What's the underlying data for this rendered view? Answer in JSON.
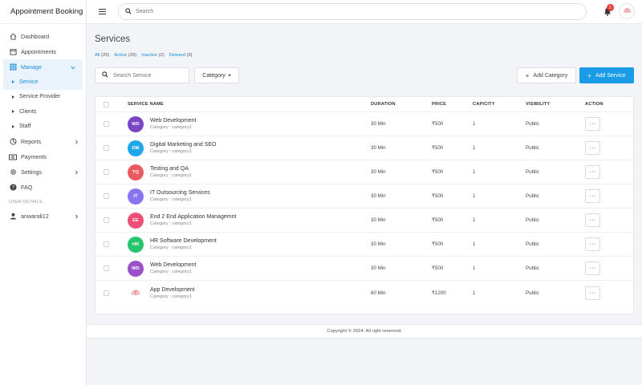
{
  "app": {
    "title": "Appointment Booking"
  },
  "topbar": {
    "search_placeholder": "Search",
    "notifications_count": "5"
  },
  "sidebar": {
    "items": [
      {
        "label": "Dashboard",
        "icon": "home-icon"
      },
      {
        "label": "Appointments",
        "icon": "calendar-icon"
      },
      {
        "label": "Manage",
        "icon": "grid-icon"
      },
      {
        "label": "Service"
      },
      {
        "label": "Service Provider"
      },
      {
        "label": "Clients"
      },
      {
        "label": "Staff"
      },
      {
        "label": "Reports",
        "icon": "reports-icon"
      },
      {
        "label": "Payments",
        "icon": "payments-icon"
      },
      {
        "label": "Settings",
        "icon": "gear-icon"
      },
      {
        "label": "FAQ",
        "icon": "help-icon"
      }
    ],
    "section_label": "USER DETAILS",
    "user": "anwarali12"
  },
  "page": {
    "title": "Services",
    "filters": [
      {
        "label": "All",
        "count": "(25)"
      },
      {
        "label": "Active",
        "count": "(20)"
      },
      {
        "label": "Inactive",
        "count": "(2)"
      },
      {
        "label": "Deleted",
        "count": "(3)"
      }
    ],
    "search_placeholder": "Search Service",
    "category_label": "Category",
    "add_category_label": "Add Category",
    "add_service_label": "Add Service"
  },
  "table": {
    "columns": [
      "SERVICE NAME",
      "DURATION",
      "PRICE",
      "CAPICITY",
      "VISIBILITY",
      "ACTION"
    ],
    "rows": [
      {
        "initials": "WD",
        "color": "#7b45c6",
        "name": "Web Development",
        "category": "Category : category1",
        "duration": "30 Min",
        "price": "₹500",
        "capacity": "1",
        "visibility": "Public"
      },
      {
        "initials": "DM",
        "color": "#1ea7ea",
        "name": "Digital Marketing and SEO",
        "category": "Category : category1",
        "duration": "30 Min",
        "price": "₹500",
        "capacity": "1",
        "visibility": "Public"
      },
      {
        "initials": "TQ",
        "color": "#ea5a5f",
        "name": "Testing and QA",
        "category": "Category : category1",
        "duration": "30 Min",
        "price": "₹500",
        "capacity": "1",
        "visibility": "Public"
      },
      {
        "initials": "IT",
        "color": "#8b74f0",
        "name": "IT Outsourcing Services",
        "category": "Category : category1",
        "duration": "30 Min",
        "price": "₹500",
        "capacity": "1",
        "visibility": "Public"
      },
      {
        "initials": "EE",
        "color": "#ee4f76",
        "name": "End 2 End Application Managemnt",
        "category": "Category : category1",
        "duration": "30 Min",
        "price": "₹500",
        "capacity": "1",
        "visibility": "Public"
      },
      {
        "initials": "HR",
        "color": "#27c46e",
        "name": "HR Software Development",
        "category": "Category : category1",
        "duration": "30 Min",
        "price": "₹500",
        "capacity": "1",
        "visibility": "Public"
      },
      {
        "initials": "WD",
        "color": "#9a50c8",
        "name": "Web Development",
        "category": "Category : category1",
        "duration": "30 Min",
        "price": "₹500",
        "capacity": "1",
        "visibility": "Public"
      },
      {
        "initials": "",
        "logo": "huawei-logo-icon",
        "color": "#e3242b",
        "name": "App Development",
        "category": "Category : category1",
        "duration": "60 Min",
        "price": "₹1200",
        "capacity": "1",
        "visibility": "Public"
      }
    ],
    "action_label": "···"
  },
  "footer": {
    "text": "Copyright © 2024. All right reserved."
  }
}
